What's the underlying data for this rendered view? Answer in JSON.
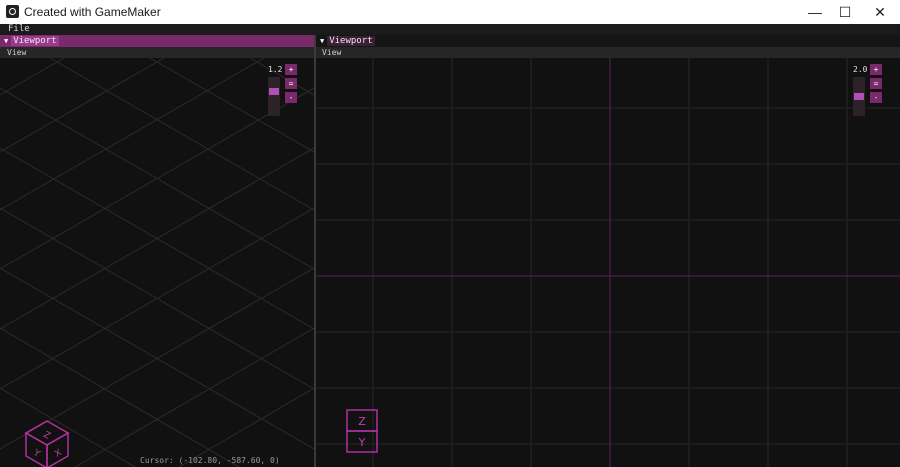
{
  "window": {
    "title": "Created with GameMaker",
    "minimize_glyph": "—",
    "maximize_glyph": "☐",
    "close_glyph": "✕"
  },
  "menu": {
    "file_label": "File"
  },
  "left_viewport": {
    "tab_label": "Viewport",
    "view_menu_label": "View",
    "zoom_value": "1.2",
    "zoom_plus": "+",
    "zoom_reset": "=",
    "zoom_minus": "-",
    "cursor_readout": "Cursor: (-102.80, -587.60, 0)",
    "gizmo_labels": [
      "Z",
      "Y",
      "X"
    ],
    "zoom_level_fraction": 0.35
  },
  "right_viewport": {
    "tab_label": "Viewport",
    "view_menu_label": "View",
    "zoom_value": "2.0",
    "zoom_plus": "+",
    "zoom_reset": "=",
    "zoom_minus": "-",
    "gizmo_labels": [
      "Z",
      "Y"
    ],
    "zoom_level_fraction": 0.5
  },
  "colors": {
    "accent": "#8a2f7a",
    "accent_bright": "#b14fb8",
    "grid": "#2a2a2a",
    "axis": "#6a2a66",
    "gizmo": "#b0309e"
  }
}
